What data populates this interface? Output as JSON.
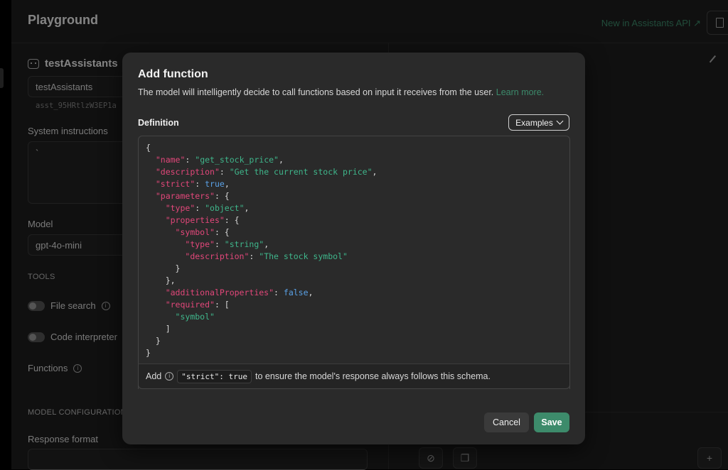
{
  "app": {
    "title": "Playground",
    "new_link": "New in Assistants API ↗"
  },
  "sidebar": {
    "assistant_name": "testAssistants",
    "name_value": "testAssistants",
    "assistant_id": "asst_95HRtlzW3EP1a",
    "system_instructions_label": "System instructions",
    "system_instructions_value": "`",
    "model_label": "Model",
    "model_value": "gpt-4o-mini",
    "tools_label": "TOOLS",
    "file_search_label": "File search",
    "code_interpreter_label": "Code interpreter",
    "functions_label": "Functions",
    "model_config_label": "MODEL CONFIGURATION",
    "response_format_label": "Response format"
  },
  "modal": {
    "title": "Add function",
    "description": "The model will intelligently decide to call functions based on input it receives from the user.",
    "learn_more": "Learn more.",
    "definition_label": "Definition",
    "examples_label": "Examples",
    "code": {
      "open": "{",
      "name_key": "\"name\"",
      "name_value": "\"get_stock_price\"",
      "description_key": "\"description\"",
      "description_value": "\"Get the current stock price\"",
      "strict_key": "\"strict\"",
      "strict_value": "true",
      "parameters_key": "\"parameters\"",
      "type_key": "\"type\"",
      "type_value": "\"object\"",
      "properties_key": "\"properties\"",
      "symbol_key": "\"symbol\"",
      "symbol_type_value": "\"string\"",
      "symbol_description_value": "\"The stock symbol\"",
      "additional_key": "\"additionalProperties\"",
      "additional_value": "false",
      "required_key": "\"required\"",
      "required_item": "\"symbol\""
    },
    "footer_prefix": "Add",
    "footer_chip": "\"strict\": true",
    "footer_suffix": "to ensure the model's response always follows this schema.",
    "cancel_label": "Cancel",
    "save_label": "Save"
  },
  "colors": {
    "accent": "#3d8b6b",
    "json_key": "#e2477a",
    "json_string": "#3fb68b",
    "json_literal": "#5aa1e6"
  },
  "icons": [
    "bot-icon",
    "book-icon",
    "brush-icon",
    "info-icon",
    "chevron-down-icon",
    "paperclip-icon",
    "copy-icon",
    "plus-icon"
  ]
}
